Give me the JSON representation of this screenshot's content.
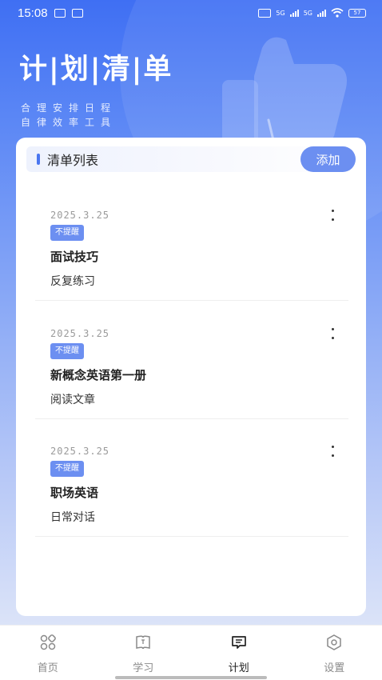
{
  "status_bar": {
    "time": "15:08",
    "net1": "5G",
    "net2": "5G",
    "battery": "57"
  },
  "hero": {
    "title": "计|划|清|单",
    "subtitle_line1": "合理安排日程",
    "subtitle_line2": "自律效率工具"
  },
  "list": {
    "header_title": "清单列表",
    "add_label": "添加",
    "items": [
      {
        "date": "2025.3.25",
        "badge": "不提醒",
        "title": "面试技巧",
        "desc": "反复练习"
      },
      {
        "date": "2025.3.25",
        "badge": "不提醒",
        "title": "新概念英语第一册",
        "desc": "阅读文章"
      },
      {
        "date": "2025.3.25",
        "badge": "不提醒",
        "title": "职场英语",
        "desc": "日常对话"
      }
    ]
  },
  "tabbar": {
    "tabs": [
      {
        "label": "首页",
        "icon": "home-grid-icon"
      },
      {
        "label": "学习",
        "icon": "book-icon"
      },
      {
        "label": "计划",
        "icon": "message-icon",
        "active": true
      },
      {
        "label": "设置",
        "icon": "hexagon-settings-icon"
      }
    ]
  },
  "colors": {
    "accent": "#6c8ff1",
    "hero_top": "#3f6ff3",
    "header_bar": "#4a76f0"
  }
}
